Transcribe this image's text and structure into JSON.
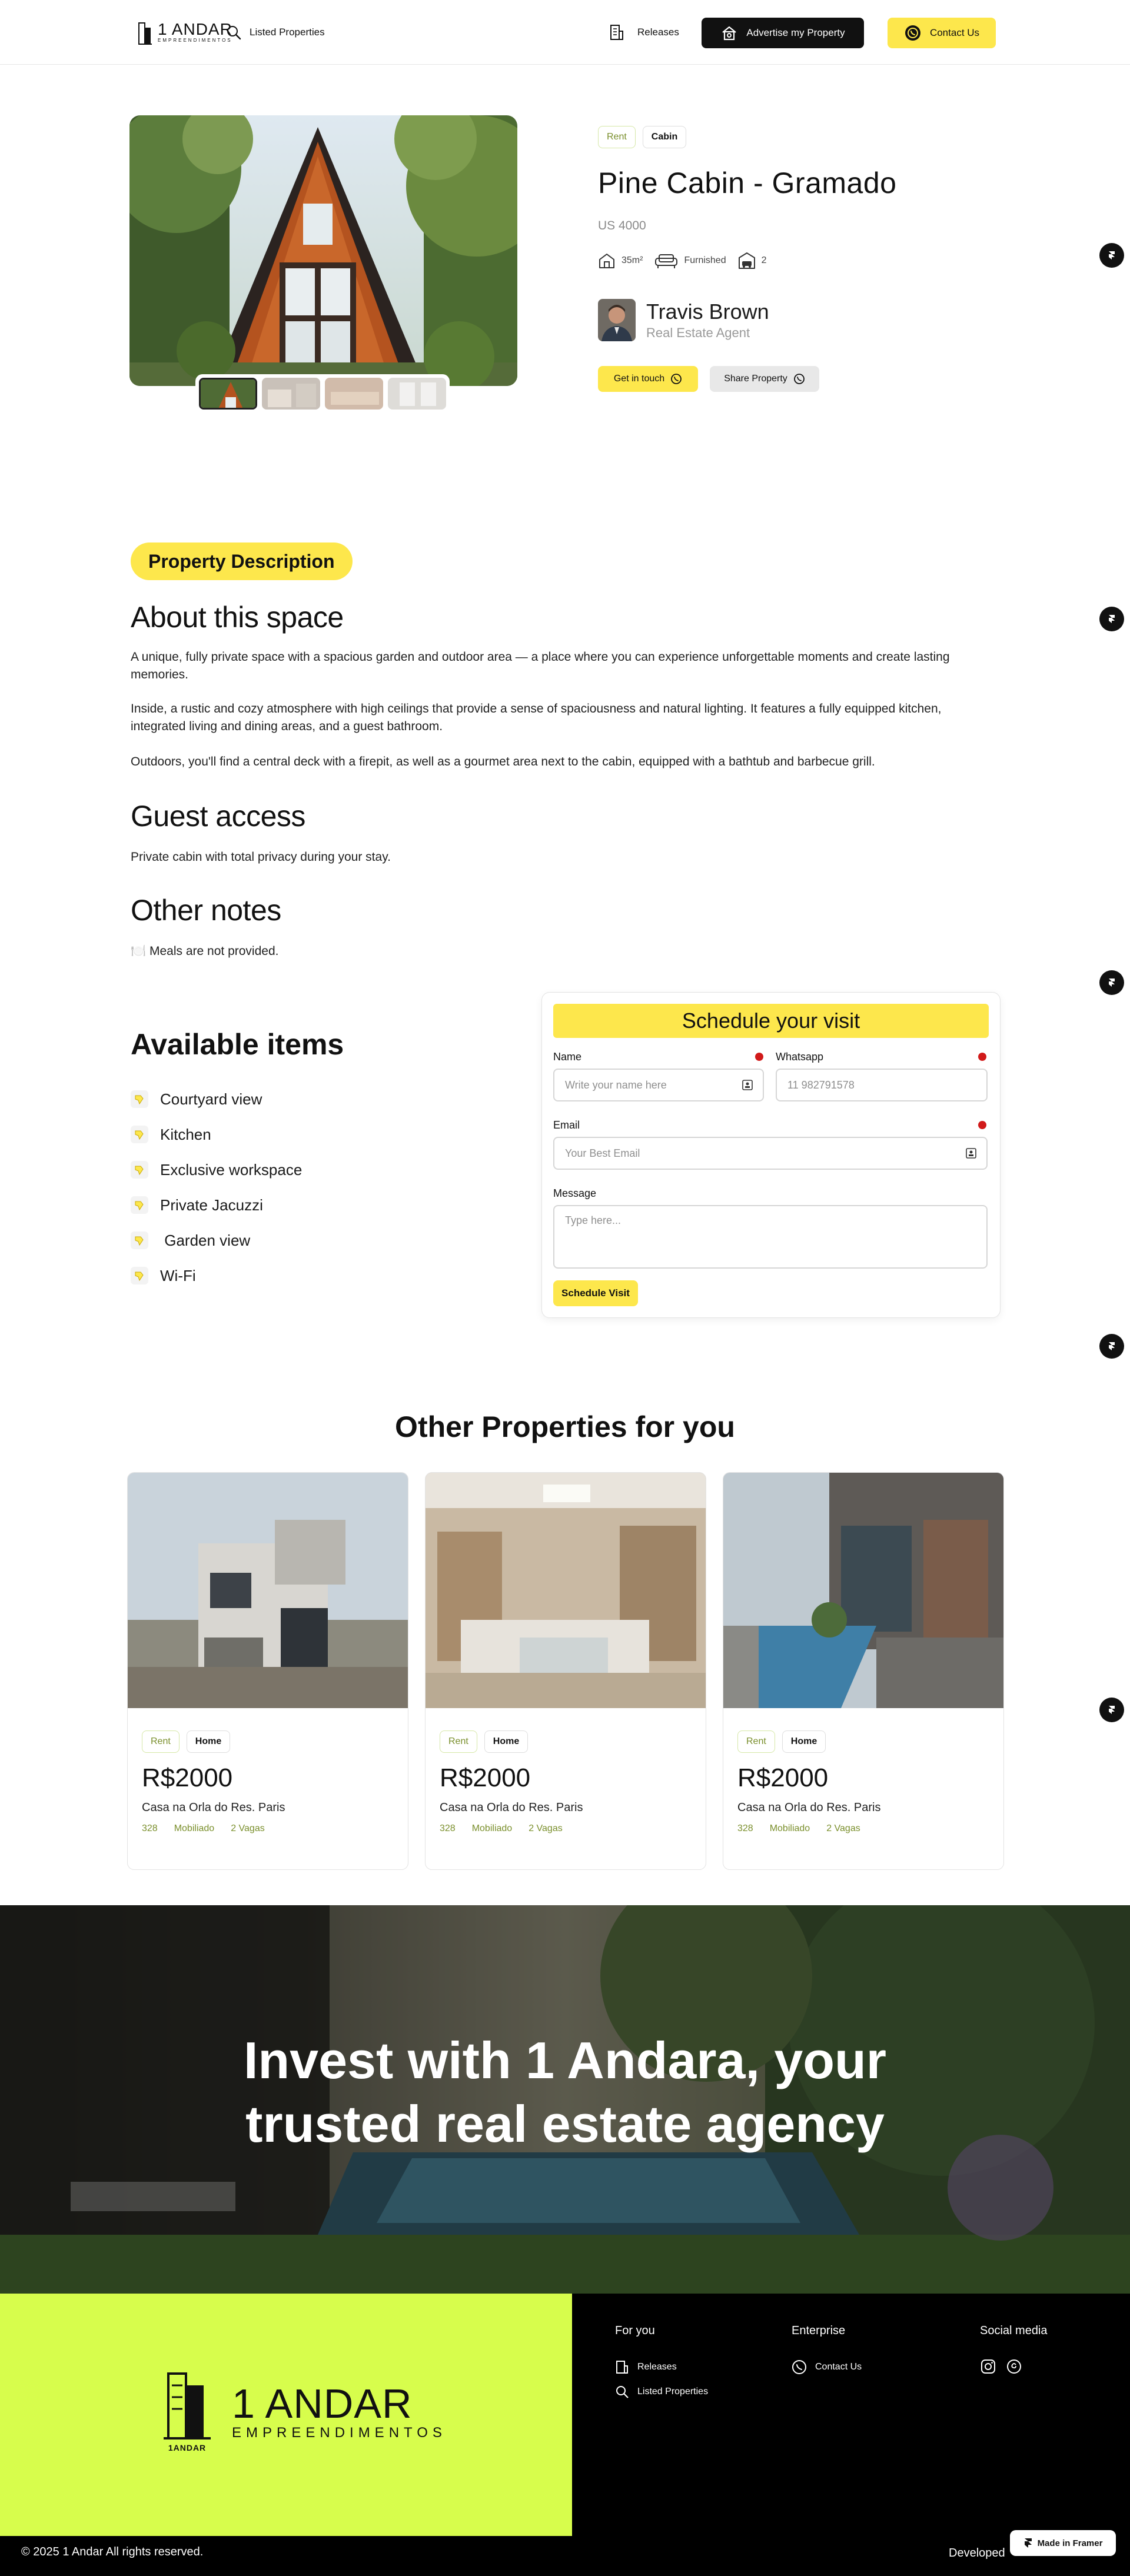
{
  "header": {
    "logo_main": "1 ANDAR",
    "logo_sub": "EMPREENDIMENTOS",
    "nav_listed": "Listed Properties",
    "nav_releases": "Releases",
    "advertise_label": "Advertise my Property",
    "contact_label": "Contact Us"
  },
  "property": {
    "tags": [
      "Rent",
      "Cabin"
    ],
    "title": "Pine Cabin - Gramado",
    "price": "US 4000",
    "area": "35m²",
    "furnished": "Furnished",
    "parking": "2",
    "agent_name": "Travis Brown",
    "agent_role": "Real Estate Agent",
    "touch_label": "Get in touch",
    "share_label": "Share Property"
  },
  "description": {
    "pill": "Property Description",
    "about_title": "About this space",
    "about_p1": "A unique, fully private space with a spacious garden and outdoor area — a place where you can experience unforgettable moments and create lasting memories.",
    "about_p2": "Inside, a rustic and cozy atmosphere with high ceilings that provide a sense of spaciousness and natural lighting. It features a fully equipped kitchen, integrated living and dining areas, and a guest bathroom.",
    "about_p3": "Outdoors, you'll find a central deck with a firepit, as well as a gourmet area next to the cabin, equipped with a bathtub and barbecue grill.",
    "guest_title": "Guest access",
    "guest_text": "Private cabin with total privacy during your stay.",
    "notes_title": "Other notes",
    "notes_icon": "🍽️",
    "notes_text": "Meals are not provided."
  },
  "items": {
    "title": "Available items",
    "list": [
      "Courtyard view",
      "Kitchen",
      "Exclusive workspace",
      "Private Jacuzzi",
      " Garden view",
      "Wi-Fi"
    ]
  },
  "form": {
    "title": "Schedule your visit",
    "name_label": "Name",
    "name_placeholder": "Write your name here",
    "whatsapp_label": "Whatsapp",
    "whatsapp_placeholder": "11 982791578",
    "email_label": "Email",
    "email_placeholder": "Your Best Email",
    "message_label": "Message",
    "message_placeholder": "Type here...",
    "submit_label": "Schedule Visit"
  },
  "other": {
    "title": "Other Properties for you",
    "cards": [
      {
        "tag1": "Rent",
        "tag2": "Home",
        "price": "R$2000",
        "address": "Casa na Orla do Res. Paris",
        "m1": "328",
        "m2": "Mobiliado",
        "m3": "2 Vagas"
      },
      {
        "tag1": "Rent",
        "tag2": "Home",
        "price": "R$2000",
        "address": "Casa na Orla do Res. Paris",
        "m1": "328",
        "m2": "Mobiliado",
        "m3": "2 Vagas"
      },
      {
        "tag1": "Rent",
        "tag2": "Home",
        "price": "R$2000",
        "address": "Casa na Orla do Res. Paris",
        "m1": "328",
        "m2": "Mobiliado",
        "m3": "2 Vagas"
      }
    ]
  },
  "banner": {
    "line1": "Invest with 1 Andara, your",
    "line2": "trusted real estate agency"
  },
  "footer": {
    "logo_main": "1 ANDAR",
    "logo_sub": "EMPREENDIMENTOS",
    "logo_small": "1ANDAR",
    "col1_title": "For you",
    "col1_links": [
      "Releases",
      "Listed Properties"
    ],
    "col2_title": "Enterprise",
    "col2_links": [
      "Contact Us"
    ],
    "col3_title": "Social media",
    "copyright": "© 2025 1 Andar All rights reserved.",
    "developed": "Developed",
    "made_in_framer": "Made in Framer"
  },
  "colors": {
    "accent_yellow": "#fde74c",
    "footer_lime": "#d7fd4c",
    "dark": "#111111",
    "rent_green": "#7a8f2c",
    "required_red": "#d11a1a"
  },
  "icons": [
    "search-icon",
    "building-icon",
    "megaphone-house-icon",
    "whatsapp-icon",
    "area-icon",
    "sofa-icon",
    "garage-icon",
    "check-hand-icon",
    "id-card-icon",
    "instagram-icon",
    "threads-icon",
    "framer-icon"
  ]
}
